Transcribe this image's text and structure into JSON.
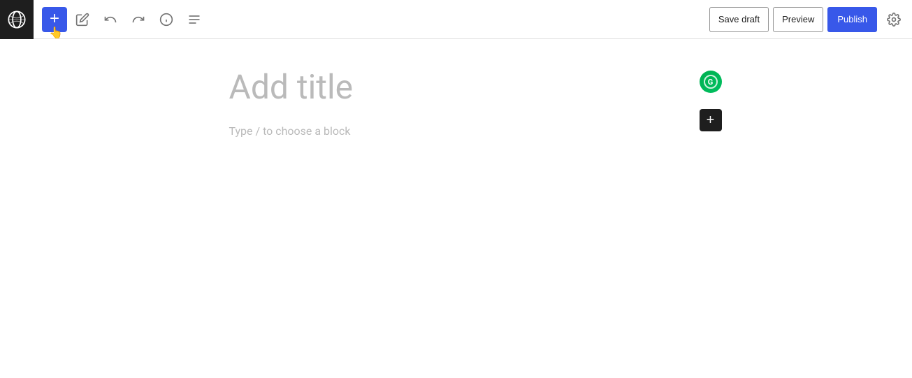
{
  "toolbar": {
    "add_block_label": "+",
    "save_draft_label": "Save draft",
    "preview_label": "Preview",
    "publish_label": "Publish"
  },
  "editor": {
    "title_placeholder": "Add title",
    "block_placeholder": "Type / to choose a block"
  },
  "colors": {
    "primary_blue": "#3858e9",
    "dark": "#1e1e1e",
    "placeholder_gray": "#bababa",
    "icon_gray": "#757575",
    "border_gray": "#949494",
    "grammarly_green": "#00b050"
  }
}
